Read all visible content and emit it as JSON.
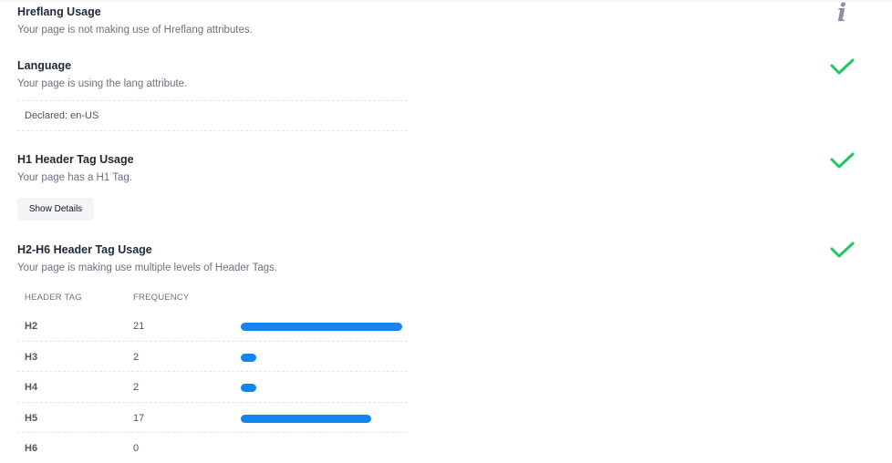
{
  "hreflang": {
    "title": "Hreflang Usage",
    "description": "Your page is not making use of Hreflang attributes.",
    "status": "info-icon",
    "icon_glyph": "i"
  },
  "language": {
    "title": "Language",
    "description": "Your page is using the lang attribute.",
    "declared": "Declared: en-US",
    "status": "check-icon"
  },
  "h1": {
    "title": "H1 Header Tag Usage",
    "description": "Your page has a H1 Tag.",
    "button_label": "Show Details",
    "status": "check-icon"
  },
  "h2h6": {
    "title": "H2-H6 Header Tag Usage",
    "description": "Your page is making use multiple levels of Header Tags.",
    "status": "check-icon",
    "columns": [
      "HEADER TAG",
      "FREQUENCY"
    ],
    "rows": [
      {
        "tag": "H2",
        "frequency": "21",
        "value": 21
      },
      {
        "tag": "H3",
        "frequency": "2",
        "value": 2
      },
      {
        "tag": "H4",
        "frequency": "2",
        "value": 2
      },
      {
        "tag": "H5",
        "frequency": "17",
        "value": 17
      },
      {
        "tag": "H6",
        "frequency": "0",
        "value": 0
      }
    ],
    "max_value": 21
  },
  "colors": {
    "check": "#22c55e",
    "bar": "#1485ee",
    "info": "#8a8fa3"
  }
}
